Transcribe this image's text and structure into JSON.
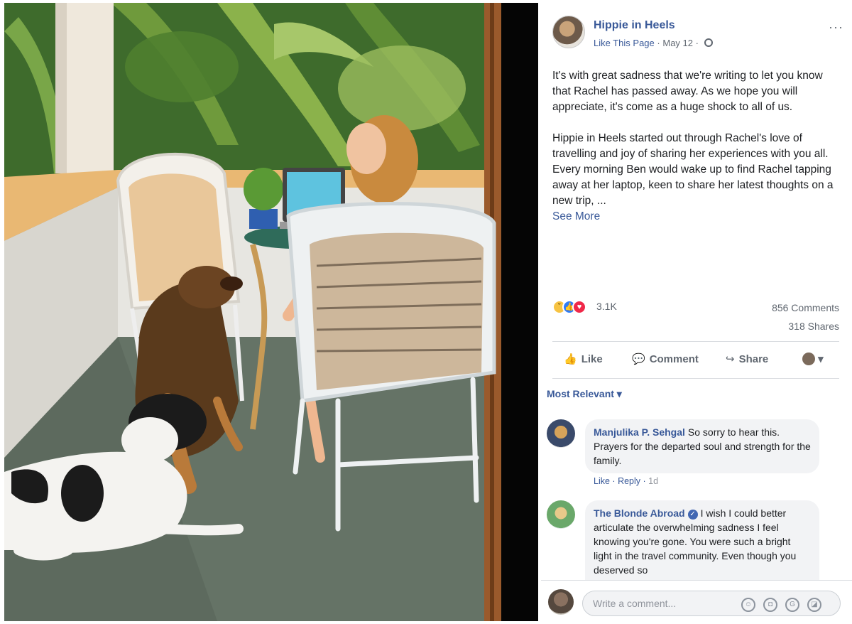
{
  "post": {
    "page_name": "Hippie in Heels",
    "like_page": "Like This Page",
    "separator": "·",
    "date": "May 12",
    "more": "···",
    "paragraph1": "It's with great sadness that we're writing to let you know that Rachel has passed away. As we hope you will appreciate, it's come as a huge shock to all of us.",
    "paragraph2": "Hippie in Heels started out through Rachel's love of travelling and joy of sharing her experiences with you all. Every morning Ben would wake up to find Rachel tapping away at her laptop, keen to share her latest thoughts on a new trip, ...",
    "see_more": "See More"
  },
  "stats": {
    "reaction_count": "3.1K",
    "comments": "856 Comments",
    "shares": "318 Shares"
  },
  "actions": {
    "like": "Like",
    "comment": "Comment",
    "share": "Share"
  },
  "comments_section": {
    "sort": "Most Relevant ▾",
    "items": [
      {
        "author": "Manjulika P. Sehgal",
        "text": "So sorry to hear this. Prayers for the departed soul and strength for the family.",
        "like": "Like",
        "reply": "Reply",
        "time": "1d"
      },
      {
        "author": "The Blonde Abroad",
        "text": "I wish I could better articulate the overwhelming sadness I feel knowing you're gone. You were such a bright light in the travel community. Even though you deserved so"
      }
    ]
  },
  "composer": {
    "placeholder": "Write a comment..."
  },
  "colors": {
    "link_blue": "#385898",
    "secondary_text": "#606770",
    "bubble_bg": "#f2f3f5"
  }
}
